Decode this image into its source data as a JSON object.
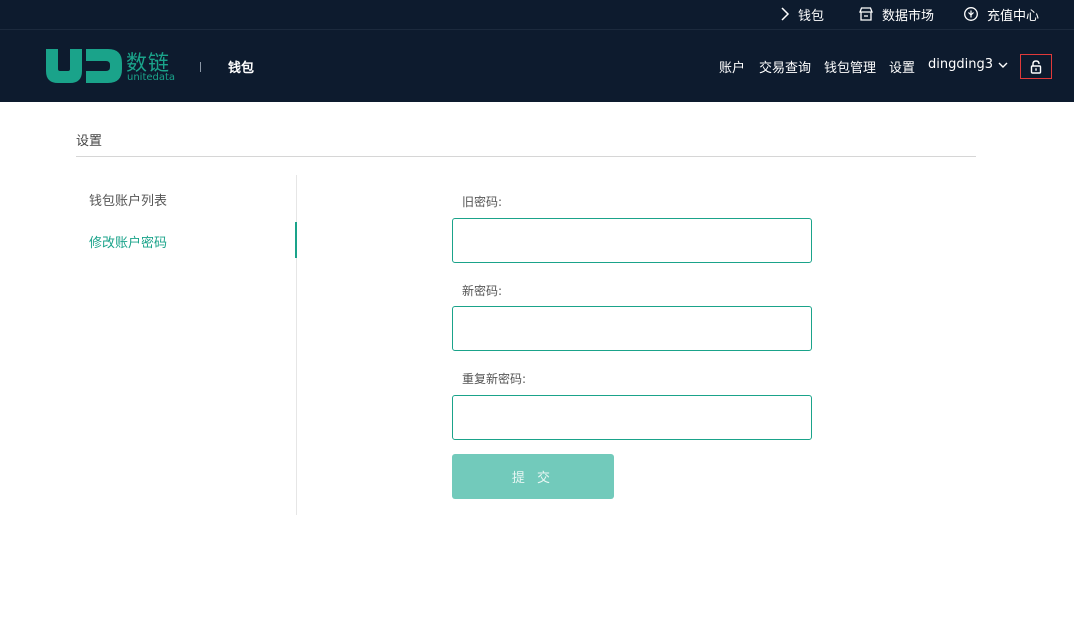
{
  "topbar": {
    "wallet_label": "钱包",
    "market_label": "数据市场",
    "recharge_label": "充值中心"
  },
  "header": {
    "logo_cn": "数链",
    "logo_en": "unitedata",
    "title": "钱包",
    "nav": {
      "account": "账户",
      "transactions": "交易查询",
      "wallet_management": "钱包管理",
      "settings": "设置",
      "username": "dingding3"
    },
    "icons": {
      "lock": "lock-icon",
      "user_dropdown": "chevron-down-icon"
    }
  },
  "breadcrumb": "设置",
  "sidebar": {
    "items": [
      {
        "label": "钱包账户列表",
        "active": false
      },
      {
        "label": "修改账户密码",
        "active": true
      }
    ]
  },
  "form": {
    "old_password_label": "旧密码:",
    "new_password_label": "新密码:",
    "repeat_password_label": "重复新密码:",
    "old_password_value": "",
    "new_password_value": "",
    "repeat_password_value": "",
    "submit_label": "提 交"
  },
  "colors": {
    "header_bg": "#0d1b2e",
    "accent": "#1aa38a",
    "submit_bg": "#72cabb",
    "lock_border": "#e03a3a"
  }
}
